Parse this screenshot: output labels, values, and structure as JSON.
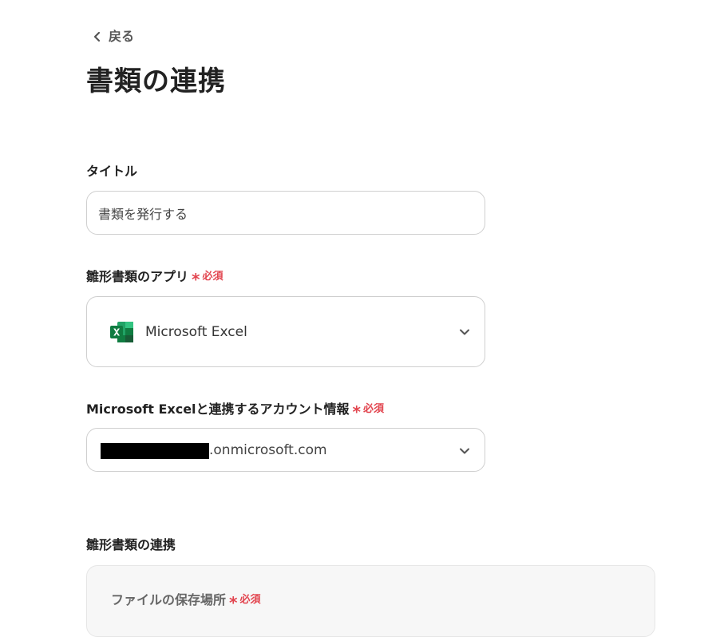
{
  "back": {
    "label": "戻る",
    "icon": "chevron-left-icon"
  },
  "page_title": "書類の連携",
  "title_field": {
    "label": "タイトル",
    "value": "書類を発行する",
    "placeholder": ""
  },
  "app_field": {
    "label": "雛形書類のアプリ",
    "required_mark": "*",
    "required_text": "必須",
    "selected_app": "Microsoft Excel",
    "icon": "excel-icon"
  },
  "account_field": {
    "label": "Microsoft Excelと連携するアカウント情報",
    "required_mark": "*",
    "required_text": "必須",
    "selected_account_domain": ".onmicrosoft.com"
  },
  "template_section": {
    "heading": "雛形書類の連携",
    "storage_field": {
      "label": "ファイルの保存場所",
      "required_mark": "*",
      "required_text": "必須"
    }
  },
  "colors": {
    "required": "#e2454f",
    "text": "#222222",
    "border": "#cfcfcf",
    "panel_bg": "#f7f7f7",
    "excel_green": "#107c41"
  }
}
